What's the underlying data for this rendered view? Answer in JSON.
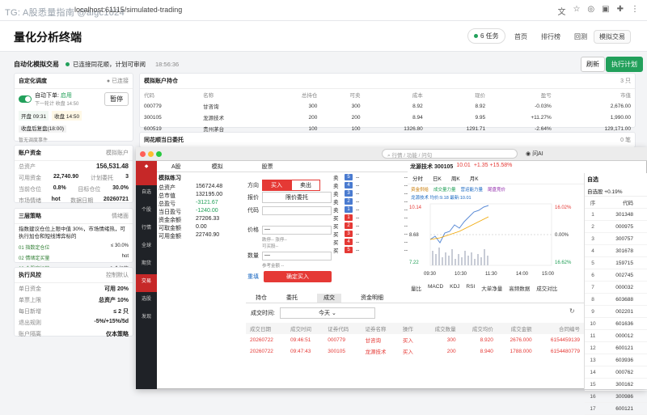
{
  "browser": {
    "watermark": "TG: A股悉量指南 @aigc1024",
    "url": "localhost:61115/simulated-trading"
  },
  "app": {
    "title": "量化分析终端",
    "task_badge": "6 任务",
    "nav": [
      "首页",
      "排行榜",
      "回测",
      "模拟交易"
    ],
    "auto_trade_label": "自动化模拟交易",
    "status_text": "已连接同花顺，计划可审阅",
    "status_time": "18:56:36",
    "btn_refresh": "刷新",
    "btn_exec": "执行计划"
  },
  "scheduler": {
    "title": "自定化调度",
    "status": "● 已连接",
    "toggle_label": "自动下单:",
    "toggle_state": "启用",
    "next_run": "下一轮计 收盘 14:50",
    "pause": "暂停",
    "open_time": "开盘 09:31",
    "close_time": "收盘 14:50",
    "after_close": "收盘后复盘(18:00)",
    "link": "暂无调度事件"
  },
  "positions": {
    "title": "模拟账户持仓",
    "count": "3 只",
    "headers": [
      "代码",
      "名称",
      "总持仓",
      "可卖",
      "成本",
      "现价",
      "盈亏",
      "市值"
    ],
    "rows": [
      [
        "000779",
        "甘咨询",
        "300",
        "300",
        "8.92",
        "8.92",
        "-0.03%",
        "2,676.00"
      ],
      [
        "300105",
        "龙源技术",
        "200",
        "200",
        "8.94",
        "9.95",
        "+11.27%",
        "1,990.00"
      ],
      [
        "600519",
        "贵州茅台",
        "100",
        "100",
        "1326.80",
        "1291.71",
        "-2.64%",
        "129,171.00"
      ]
    ]
  },
  "orders_section": {
    "title": "同花顺当日委托",
    "count": "0 笔"
  },
  "account": {
    "title": "账户资金",
    "right": "模拟账户",
    "rows": [
      [
        "总资产",
        "156,531.48"
      ],
      [
        "可用资金",
        "22,740.90"
      ],
      [
        "计划委托",
        "3"
      ],
      [
        "当前仓位",
        "0.8%"
      ],
      [
        "目标仓位",
        "30.0%"
      ],
      [
        "市场情绪",
        "hot"
      ],
      [
        "数据日期",
        "20260721"
      ]
    ]
  },
  "strategy": {
    "title": "三层策略",
    "right": "情绪面",
    "desc": "指数建议仓位上限中值 30%，市场情绪热，可执行加仓和短线博弈标的",
    "items": [
      [
        "01 指数定仓位",
        "≤ 30.0%"
      ],
      [
        "02 情绪定买量",
        "hot"
      ],
      [
        "03 个股定标的",
        "0 个标的"
      ]
    ]
  },
  "risk": {
    "title": "执行风控",
    "right": "控制默认",
    "rows": [
      [
        "单日资金",
        "可用 20%"
      ],
      [
        "单票上限",
        "总资产 10%"
      ],
      [
        "每日新增",
        "≤ 2 只"
      ],
      [
        "退出规则",
        "-5%/+15%/5d"
      ],
      [
        "账户隔离",
        "仅本策略"
      ]
    ]
  },
  "ths": {
    "search": "行情 / 功能 / 问句",
    "ai": "问AI",
    "tabs": [
      "A股",
      "模拟",
      "股票"
    ],
    "account_title": "模拟练习",
    "acct": [
      [
        "总资产",
        "156724.48"
      ],
      [
        "总市值",
        "132195.00"
      ],
      [
        "总盈亏",
        "-3121.67"
      ],
      [
        "当日盈亏",
        "-1240.00"
      ],
      [
        "资金余额",
        "27206.33"
      ],
      [
        "可取金额",
        "0.00"
      ],
      [
        "可用金额",
        "22740.90"
      ]
    ],
    "side_buy": "买入",
    "side_sell": "卖出",
    "dir_label": "方向",
    "price_type_label": "报价",
    "price_type": "限价委托",
    "code_label": "代码",
    "price_label": "价格",
    "price_hint": "跌停--  涨停--",
    "buyable": "可买股--",
    "qty_label": "数量",
    "est_amount": "参考金额 --",
    "reset": "重填",
    "confirm": "确定买入",
    "sidebar": [
      "自选",
      "个股",
      "行情",
      "全球",
      "期货",
      "交易",
      "选股",
      "发现"
    ],
    "stock_name": "龙源技术 300105",
    "stock_price": "10.01",
    "stock_change": "+1.35 +15.58%",
    "chart_tabs": [
      "分时",
      "日K",
      "周K",
      "月K"
    ],
    "chart_legend": [
      "资金供给",
      "成交量力量",
      "营运能力量",
      "尾盘竞价"
    ],
    "chart_sub": "龙源技术 均价:9.18 最新:10.01",
    "y_left": [
      "10.14",
      "8.68",
      "7.22"
    ],
    "y_right": [
      "16.02%",
      "0.00%",
      "16.62%"
    ],
    "x_ticks": [
      "09:30",
      "10:30",
      "11:30",
      "14:00",
      "15:00"
    ],
    "ind_tabs": [
      "量比",
      "MACD",
      "KDJ",
      "RSI",
      "大单净量",
      "高频数据",
      "成交对比"
    ],
    "watch_title": "自选",
    "watch_sub": "自选股 +0.19%",
    "watch_header": [
      "序",
      "代码"
    ],
    "watch": [
      [
        "1",
        "301348"
      ],
      [
        "2",
        "000975"
      ],
      [
        "3",
        "300757"
      ],
      [
        "4",
        "301678"
      ],
      [
        "5",
        "159715"
      ],
      [
        "6",
        "002745"
      ],
      [
        "7",
        "000032"
      ],
      [
        "8",
        "603688"
      ],
      [
        "9",
        "002201"
      ],
      [
        "10",
        "601636"
      ],
      [
        "11",
        "000012"
      ],
      [
        "12",
        "600121"
      ],
      [
        "13",
        "603936"
      ],
      [
        "14",
        "000762"
      ],
      [
        "15",
        "300162"
      ],
      [
        "16",
        "300986"
      ],
      [
        "17",
        "600121"
      ]
    ],
    "bottom_tabs": [
      "持仓",
      "委托",
      "成交",
      "资金明细"
    ],
    "deal_time_label": "成交时间:",
    "deal_time": "今天",
    "deal_headers": [
      "成交日期",
      "成交时间",
      "证券代码",
      "证券名称",
      "操作",
      "成交数量",
      "成交均价",
      "成交金额",
      "合同编号"
    ],
    "deals": [
      [
        "20260722",
        "09:46:51",
        "000779",
        "甘咨询",
        "买入",
        "300",
        "8.920",
        "2676.000",
        "6154459139"
      ],
      [
        "20260722",
        "09:47:43",
        "300105",
        "龙源技术",
        "买入",
        "200",
        "8.940",
        "1788.000",
        "6154480779"
      ]
    ]
  },
  "colors": {
    "accent_red": "#e53935",
    "accent_green": "#22a05b",
    "dark_sidebar": "#1f2227"
  }
}
